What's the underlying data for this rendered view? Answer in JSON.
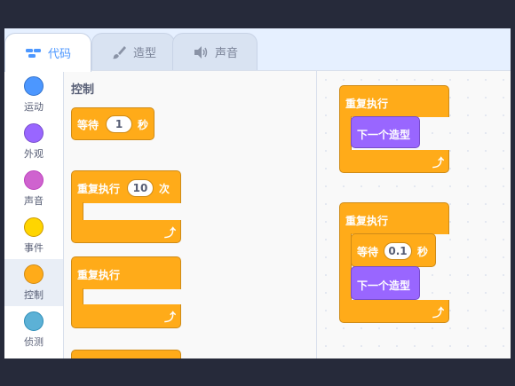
{
  "tabs": [
    {
      "label": "代码",
      "icon": "code-icon",
      "active": true
    },
    {
      "label": "造型",
      "icon": "brush-icon",
      "active": false
    },
    {
      "label": "声音",
      "icon": "speaker-icon",
      "active": false
    }
  ],
  "categories": [
    {
      "label": "运动",
      "color": "#4c97ff"
    },
    {
      "label": "外观",
      "color": "#9966ff"
    },
    {
      "label": "声音",
      "color": "#cf63cf"
    },
    {
      "label": "事件",
      "color": "#ffd500"
    },
    {
      "label": "控制",
      "color": "#ffab19"
    },
    {
      "label": "侦测",
      "color": "#5cb1d6"
    }
  ],
  "palette": {
    "section_title": "控制",
    "wait": {
      "label": "等待",
      "value": "1",
      "unit": "秒"
    },
    "repeat_n": {
      "label": "重复执行",
      "value": "10",
      "unit": "次"
    },
    "forever": {
      "label": "重复执行"
    }
  },
  "script": {
    "script1": {
      "forever": "重复执行",
      "next_costume": "下一个造型"
    },
    "script2": {
      "forever": "重复执行",
      "wait_label": "等待",
      "wait_value": "0.1",
      "wait_unit": "秒",
      "next_costume": "下一个造型"
    }
  },
  "colors": {
    "control": "#ffab19",
    "looks": "#9966ff",
    "accent": "#4c97ff"
  }
}
